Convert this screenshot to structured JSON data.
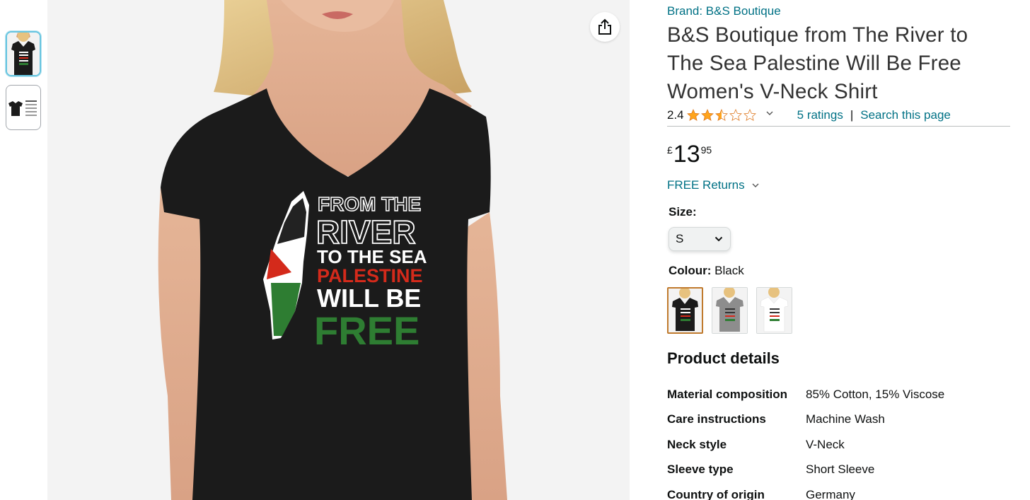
{
  "thumbnails": [
    {
      "alt": "front view"
    },
    {
      "alt": "product detail"
    }
  ],
  "product": {
    "brand": "Brand: B&S Boutique",
    "title": "B&S Boutique from The River to The Sea Palestine Will Be Free Women's V-Neck Shirt",
    "print_lines": [
      "FROM THE",
      "RIVER",
      "TO THE SEA",
      "PALESTINE",
      "WILL BE",
      "FREE"
    ]
  },
  "rating": {
    "value": "2.4",
    "stars": 2.4,
    "count_label": "5 ratings",
    "separator": "|",
    "search_label": "Search this page"
  },
  "price": {
    "symbol": "£",
    "whole": "13",
    "fraction": "95"
  },
  "returns": {
    "label": "FREE Returns"
  },
  "size": {
    "label": "Size:",
    "selected": "S"
  },
  "colour": {
    "label": "Colour:",
    "value": "Black",
    "options": [
      "Black",
      "Grey",
      "White"
    ]
  },
  "details": {
    "heading": "Product details",
    "rows": [
      {
        "key": "Material composition",
        "value": "85% Cotton, 15% Viscose"
      },
      {
        "key": "Care instructions",
        "value": "Machine Wash"
      },
      {
        "key": "Neck style",
        "value": "V-Neck"
      },
      {
        "key": "Sleeve type",
        "value": "Short Sleeve"
      },
      {
        "key": "Country of origin",
        "value": "Germany"
      }
    ]
  },
  "colors": {
    "link": "#007185",
    "star": "#ffa41c",
    "shirt": "#1b1b1b",
    "flag_red": "#d42a1b",
    "flag_green": "#2e7d32"
  }
}
